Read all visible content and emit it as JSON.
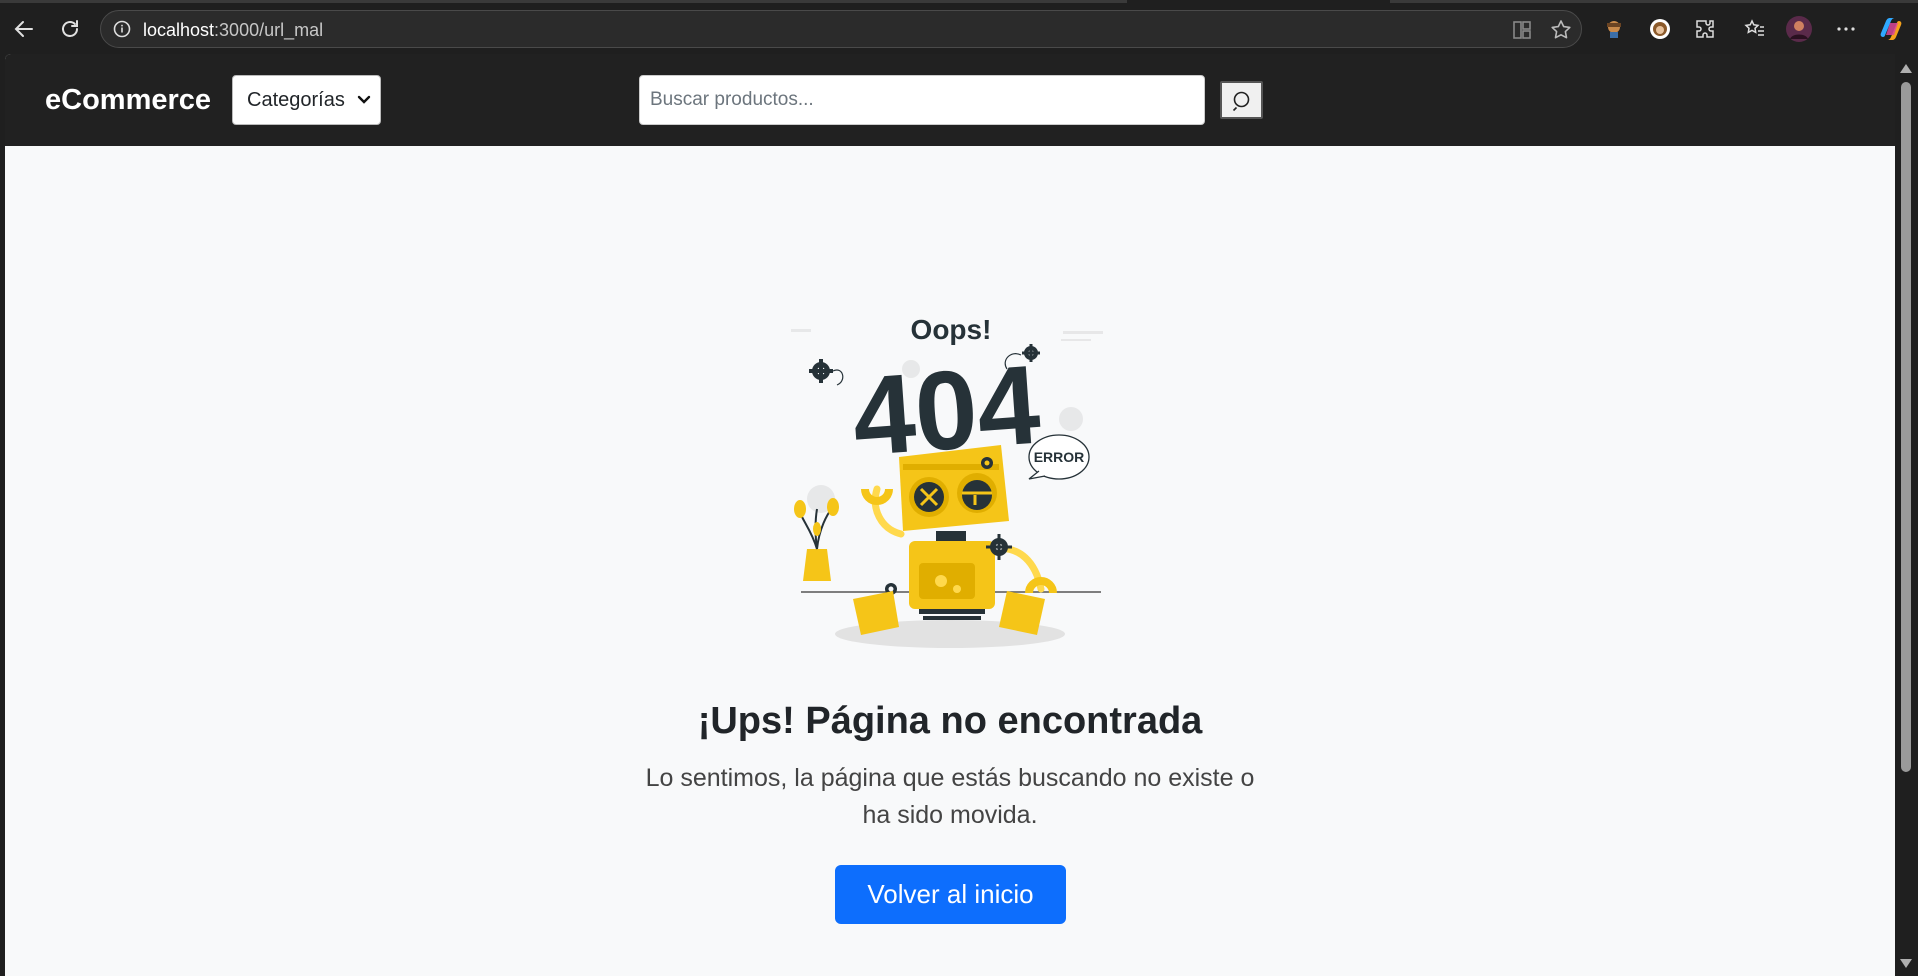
{
  "browser": {
    "url_host": "localhost",
    "url_path": ":3000/url_mal"
  },
  "navbar": {
    "brand": "eCommerce",
    "categories_label": "Categorías",
    "search_placeholder": "Buscar productos..."
  },
  "illustration": {
    "oops": "Oops!",
    "code": "404",
    "error": "ERROR"
  },
  "error_page": {
    "title": "¡Ups! Página no encontrada",
    "message": "Lo sentimos, la página que estás buscando no existe o ha sido movida.",
    "home_button": "Volver al inicio"
  },
  "colors": {
    "primary": "#0d6efd",
    "navbar_bg": "#212121",
    "robot_yellow": "#f5c518"
  }
}
